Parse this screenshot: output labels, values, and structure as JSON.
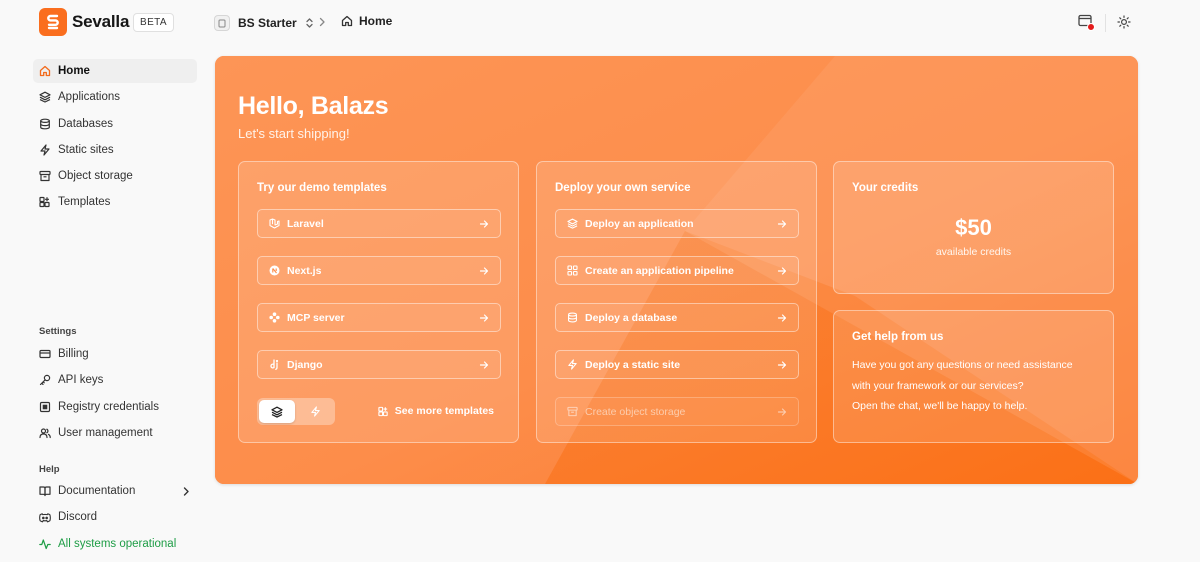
{
  "app": {
    "name": "Sevalla",
    "badge": "BETA"
  },
  "header": {
    "project": "BS Starter",
    "breadcrumb": "Home"
  },
  "sidebar": {
    "items": [
      {
        "label": "Home",
        "icon": "home-icon"
      },
      {
        "label": "Applications",
        "icon": "layers-icon"
      },
      {
        "label": "Databases",
        "icon": "database-icon"
      },
      {
        "label": "Static sites",
        "icon": "bolt-icon"
      },
      {
        "label": "Object storage",
        "icon": "archive-icon"
      },
      {
        "label": "Templates",
        "icon": "grid-plus-icon"
      }
    ],
    "settings": {
      "label": "Settings",
      "items": [
        {
          "label": "Billing",
          "icon": "credit-card-icon"
        },
        {
          "label": "API keys",
          "icon": "key-icon"
        },
        {
          "label": "Registry credentials",
          "icon": "registry-icon"
        },
        {
          "label": "User management",
          "icon": "users-icon"
        }
      ]
    },
    "help": {
      "label": "Help",
      "items": [
        {
          "label": "Documentation",
          "icon": "book-icon"
        },
        {
          "label": "Discord",
          "icon": "discord-icon"
        },
        {
          "label": "All systems operational",
          "icon": "activity-icon"
        }
      ]
    }
  },
  "hero": {
    "title": "Hello, Balazs",
    "subtitle": "Let's start shipping!"
  },
  "templates_card": {
    "title": "Try our demo templates",
    "items": [
      "Laravel",
      "Next.js",
      "MCP server",
      "Django"
    ],
    "see_more": "See more templates"
  },
  "deploy_card": {
    "title": "Deploy your own service",
    "items": [
      "Deploy an application",
      "Create an application pipeline",
      "Deploy a database",
      "Deploy a static site",
      "Create object storage"
    ]
  },
  "credits_card": {
    "title": "Your credits",
    "amount": "$50",
    "label": "available credits"
  },
  "help_card": {
    "title": "Get help from us",
    "lines": [
      "Have you got any questions or need assistance",
      "with your framework or our services?",
      "Open the chat, we'll be happy to help."
    ]
  },
  "colors": {
    "brand": "#fa6e1e",
    "hero_light": "#fd9a5d",
    "hero_dark": "#fa7421",
    "status_ok": "#1e9d46",
    "notification": "#e31b1b"
  }
}
